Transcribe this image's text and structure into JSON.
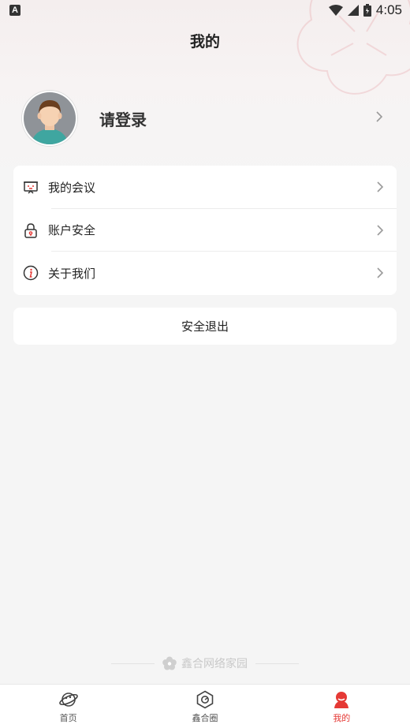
{
  "status_bar": {
    "badge": "A",
    "time": "4:05"
  },
  "header": {
    "title": "我的"
  },
  "profile": {
    "login_prompt": "请登录"
  },
  "menu": {
    "items": [
      {
        "label": "我的会议",
        "icon": "meeting-icon"
      },
      {
        "label": "账户安全",
        "icon": "lock-icon"
      },
      {
        "label": "关于我们",
        "icon": "info-icon"
      }
    ]
  },
  "logout": {
    "label": "安全退出"
  },
  "footer": {
    "brand": "鑫合网络家园"
  },
  "tabbar": {
    "tabs": [
      {
        "label": "首页",
        "icon": "planet-icon"
      },
      {
        "label": "鑫合圈",
        "icon": "hexagon-icon"
      },
      {
        "label": "我的",
        "icon": "person-icon"
      }
    ],
    "active_index": 2
  },
  "colors": {
    "accent": "#e53935",
    "background": "#f5f5f5"
  }
}
